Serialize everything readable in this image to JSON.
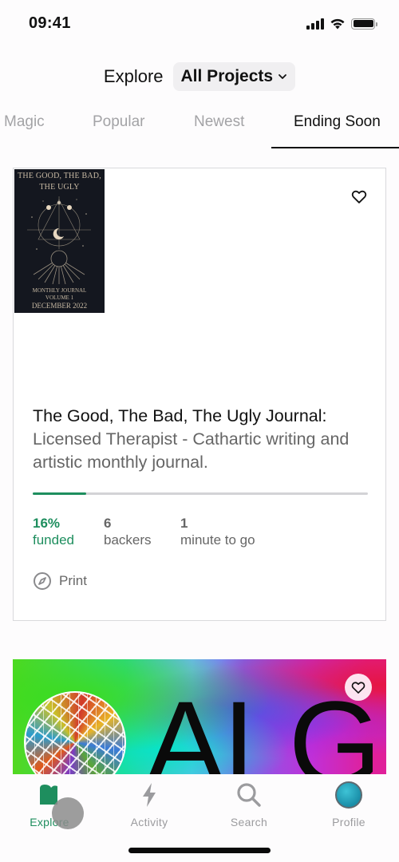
{
  "status_bar": {
    "time": "09:41"
  },
  "header": {
    "title": "Explore",
    "project_filter": "All Projects"
  },
  "tabs": [
    {
      "label": "Magic",
      "active": false
    },
    {
      "label": "Popular",
      "active": false
    },
    {
      "label": "Newest",
      "active": false
    },
    {
      "label": "Ending Soon",
      "active": true
    }
  ],
  "projects": [
    {
      "cover": {
        "title_line1": "THE GOOD, THE BAD,",
        "title_line2": "THE UGLY",
        "subtitle_line1": "MONTHLY JOURNAL",
        "subtitle_line2": "VOLUME 1",
        "date": "DECEMBER 2022"
      },
      "name": "The Good, The Bad, The Ugly Journal:",
      "blurb": "Licensed Therapist - Cathartic writing and artistic monthly journal.",
      "progress_percent": 16,
      "stats": {
        "funded_value": "16%",
        "funded_label": "funded",
        "backers_value": "6",
        "backers_label": "backers",
        "time_value": "1",
        "time_label": "minute to go"
      },
      "category": "Print",
      "saved": false
    },
    {
      "image_text": "ALG",
      "saved": false
    }
  ],
  "tabbar": [
    {
      "label": "Explore",
      "icon": "explore-icon",
      "active": true
    },
    {
      "label": "Activity",
      "icon": "lightning-icon",
      "active": false
    },
    {
      "label": "Search",
      "icon": "search-icon",
      "active": false
    },
    {
      "label": "Profile",
      "icon": "avatar",
      "active": false
    }
  ],
  "colors": {
    "accent_green": "#1e8e5e",
    "inactive_gray": "#9b9b9e"
  }
}
